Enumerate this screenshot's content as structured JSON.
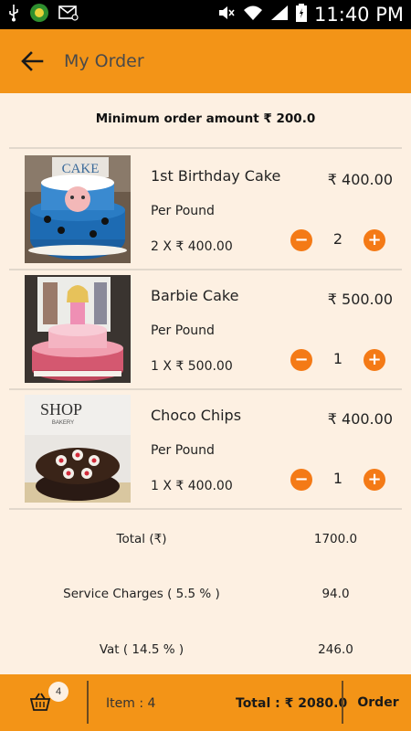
{
  "status_bar": {
    "time": "11:40 PM"
  },
  "header": {
    "title": "My Order"
  },
  "minimum_order": "Minimum order amount ₹ 200.0",
  "items": [
    {
      "name": "1st Birthday Cake",
      "price": "₹ 400.00",
      "unit": "Per Pound",
      "calc": "2 X ₹ 400.00",
      "quantity": "2",
      "image_label": "CAKE"
    },
    {
      "name": "Barbie Cake",
      "price": "₹ 500.00",
      "unit": "Per Pound",
      "calc": "1 X ₹ 500.00",
      "quantity": "1"
    },
    {
      "name": "Choco Chips",
      "price": "₹ 400.00",
      "unit": "Per Pound",
      "calc": "1 X ₹ 400.00",
      "quantity": "1",
      "image_label": "SHOP",
      "image_sublabel": "BAKERY"
    }
  ],
  "summary": [
    {
      "label": "Total (₹)",
      "value": "1700.0"
    },
    {
      "label": "Service Charges ( 5.5 % )",
      "value": "94.0"
    },
    {
      "label": "Vat ( 14.5 % )",
      "value": "246.0"
    }
  ],
  "bottom_bar": {
    "badge": "4",
    "items_label": "Item : 4",
    "total_label": "Total : ₹ 2080.0",
    "order_label": "Order"
  },
  "controls": {
    "minus": "−",
    "plus": "+"
  },
  "colors": {
    "accent": "#f39417",
    "button": "#f47a16",
    "background": "#fdf0e2"
  }
}
